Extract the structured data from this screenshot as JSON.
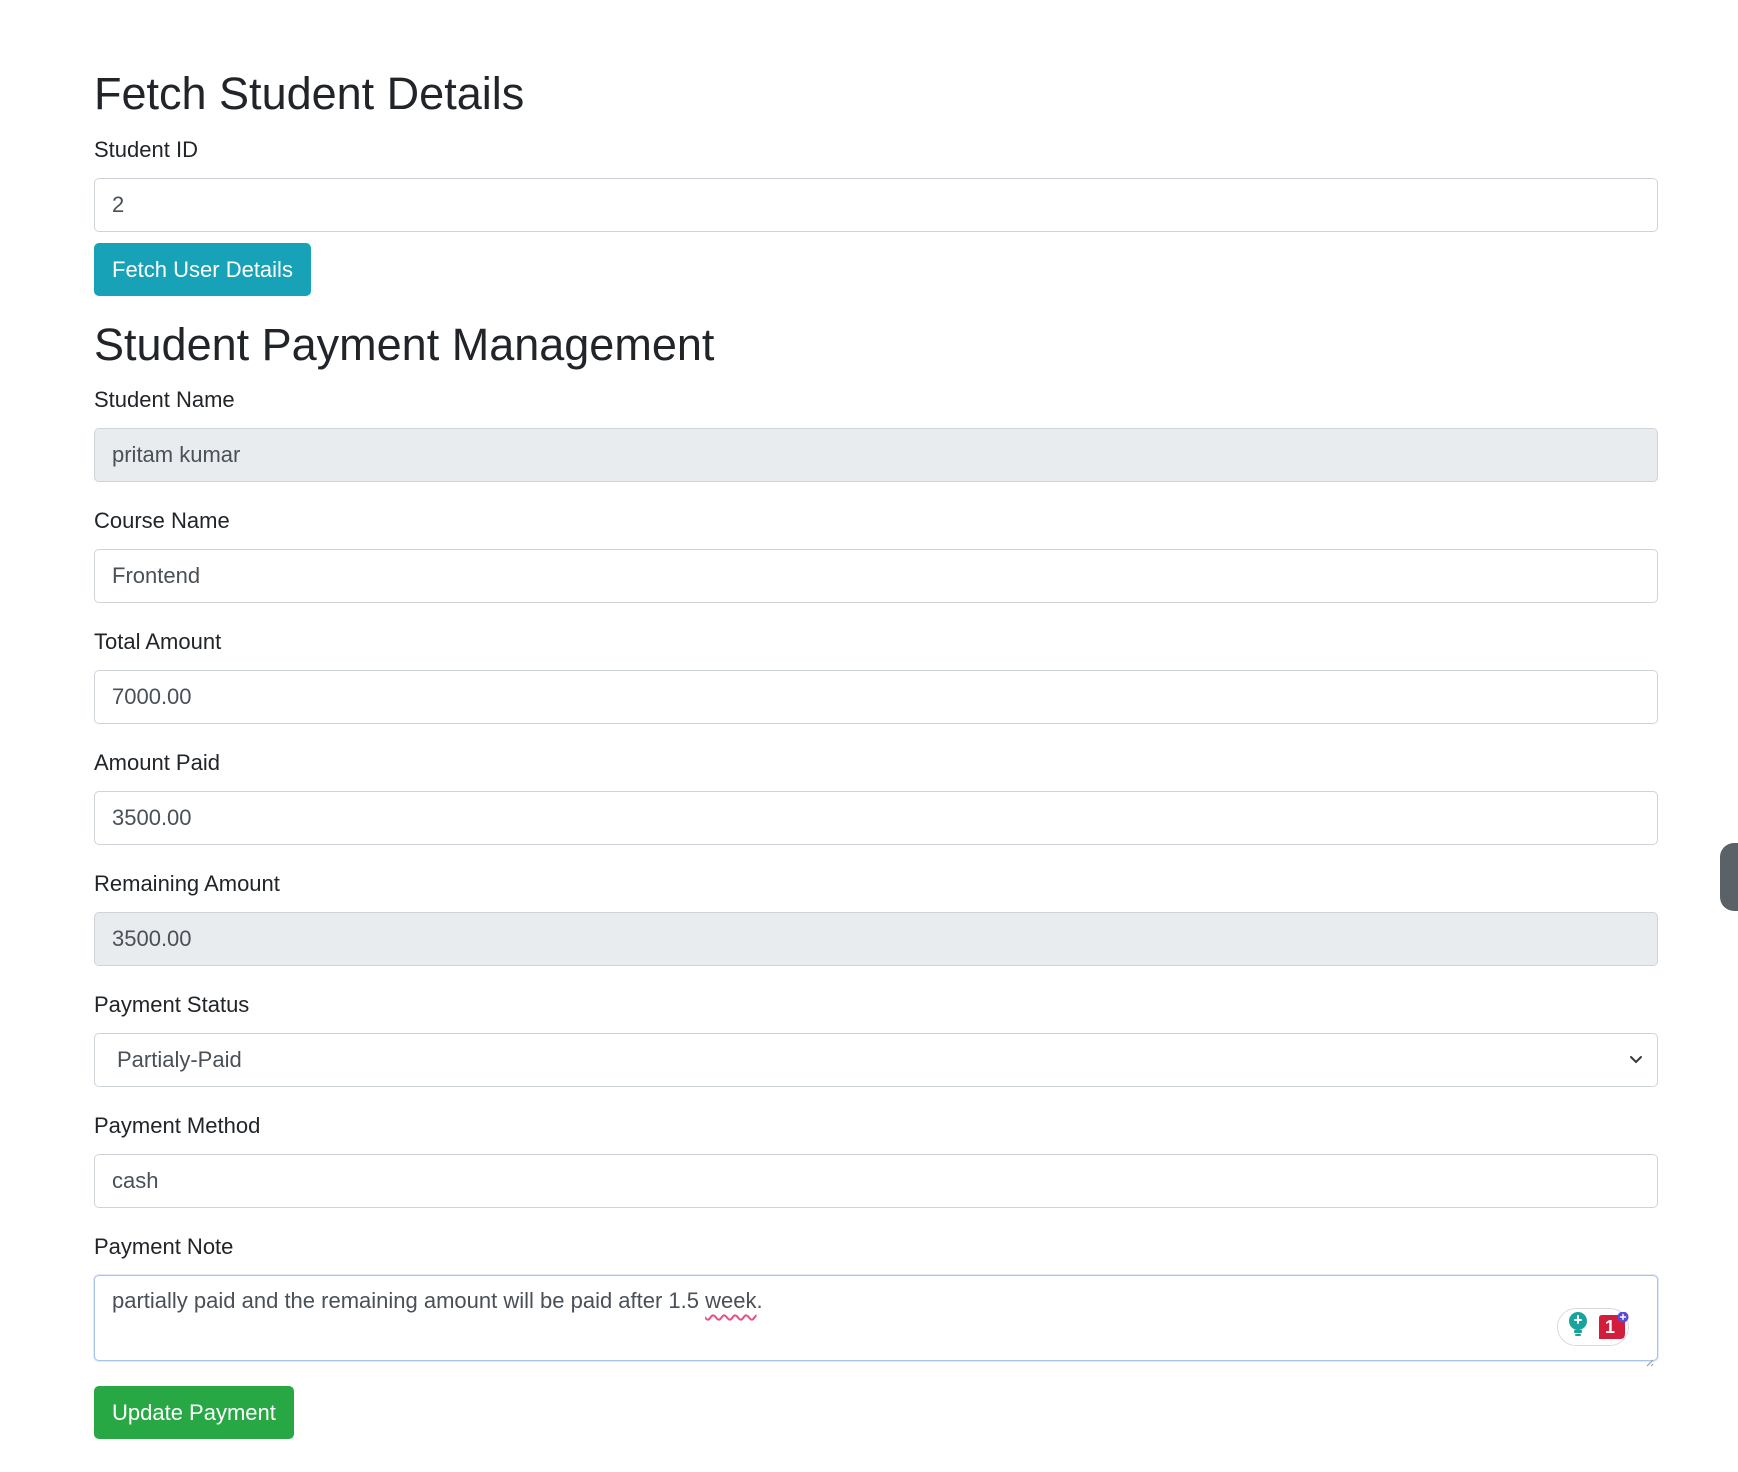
{
  "fetch_section": {
    "title": "Fetch Student Details",
    "student_id_label": "Student ID",
    "student_id_value": "2",
    "fetch_button": "Fetch User Details"
  },
  "payment_section": {
    "title": "Student Payment Management",
    "student_name": {
      "label": "Student Name",
      "value": "pritam kumar"
    },
    "course_name": {
      "label": "Course Name",
      "value": "Frontend"
    },
    "total_amount": {
      "label": "Total Amount",
      "value": "7000.00"
    },
    "amount_paid": {
      "label": "Amount Paid",
      "value": "3500.00"
    },
    "remaining_amount": {
      "label": "Remaining Amount",
      "value": "3500.00"
    },
    "payment_status": {
      "label": "Payment Status",
      "value": "Partialy-Paid"
    },
    "payment_method": {
      "label": "Payment Method",
      "value": "cash"
    },
    "payment_note": {
      "label": "Payment Note",
      "text_before": "partially paid and the remaining amount will be paid after 1.5 ",
      "misspelled_word": "week",
      "text_after": ".",
      "extension_badge_count": "1"
    },
    "update_button": "Update Payment"
  },
  "colors": {
    "info_button": "#17a2b8",
    "success_button": "#28a745",
    "readonly_bg": "#e9ecef",
    "input_border": "#ced4da",
    "spell_underline": "#e4547f"
  },
  "icons": {
    "select_chevron": "chevron-down-icon",
    "extension_bulb": "lightbulb-icon",
    "extension_badge": "error-count-badge",
    "extension_plus": "plus-icon"
  }
}
